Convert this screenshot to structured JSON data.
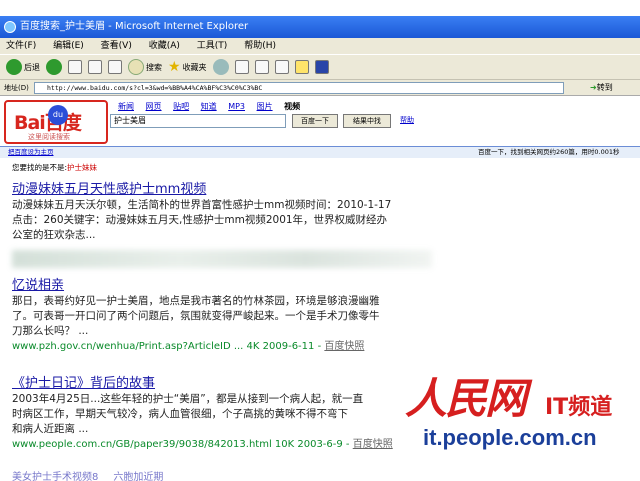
{
  "window": {
    "title": "百度搜索_护士美眉 - Microsoft Internet Explorer"
  },
  "menu": [
    "文件(F)",
    "编辑(E)",
    "查看(V)",
    "收藏(A)",
    "工具(T)",
    "帮助(H)"
  ],
  "toolbar": {
    "back": "后退",
    "search": "搜索",
    "favorites": "收藏夹"
  },
  "address": {
    "label": "地址(D)",
    "url": "http://www.baidu.com/s?cl=3&wd=%BB%A4%CA%BF%C3%C0%C3%BC",
    "go": "转到"
  },
  "baidu": {
    "logo": "Bai百度",
    "logo_sub": "这里阅读搜索",
    "tabs": [
      "新闻",
      "网页",
      "贴吧",
      "知道",
      "MP3",
      "图片",
      "视频"
    ],
    "active_tab": "网页",
    "query": "护士美眉",
    "search_button": "百度一下",
    "result_button": "结果中找",
    "help": "帮助",
    "set_home": "把百度设为主页",
    "stats": "百度一下，找到相关网页约260篇，用时0.001秒",
    "suggest_prefix": "您要找的是不是:",
    "suggest_kw": "护士妹妹"
  },
  "results": [
    {
      "title": "动漫妹妹五月天性感护士mm视频",
      "desc1": "动漫妹妹五月天沃尔顿，生活简朴的世界首富性感护士mm视频时间：2010-1-17",
      "desc2": "点击：260关键字：动漫妹妹五月天,性感护士mm视频2001年，世界权威财经办",
      "desc3": "公室的狂欢杂志..."
    },
    {
      "title": "忆说相亲",
      "desc1": "那日，表哥约好见一护士美眉，地点是我市著名的竹林茶园，环境是够浪漫幽雅",
      "desc2": "了。可表哥一开口问了两个问题后，氛围就变得严峻起来。一个是手术刀像零牛",
      "desc3": "刀那么长吗？ ...",
      "url": "www.pzh.gov.cn/wenhua/Print.asp?ArticleID ... 4K 2009-6-11 -",
      "snap": "百度快照"
    },
    {
      "title": "《护士日记》背后的故事",
      "desc1": "2003年4月25日...这些年轻的护士“美眉”，都是从接到一个病人起，就一直",
      "desc2": "时病区工作，早期天气较冷，病人血管很细，个子高挑的黄咪不得不弯下",
      "desc3": "和病人近距离 ...",
      "url": "www.people.com.cn/GB/paper39/9038/842013.html 10K 2003-6-9 -",
      "snap": "百度快照"
    }
  ],
  "tail": "美女护士手术视频8___六胞加近期",
  "watermark": {
    "brand": "人民网",
    "channel": "IT频道",
    "url": "it.people.com.cn"
  }
}
